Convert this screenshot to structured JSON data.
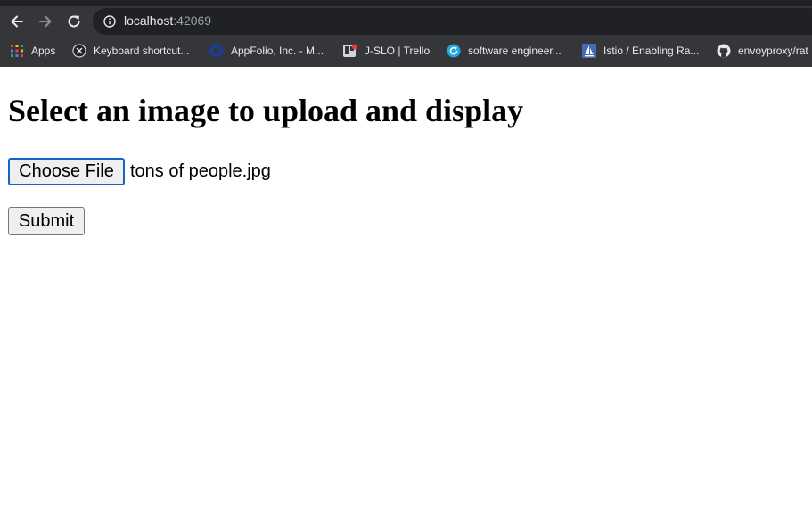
{
  "browser": {
    "url_host": "localhost",
    "url_port": ":42069",
    "icons": {
      "back": "back-arrow-icon",
      "forward": "forward-arrow-icon",
      "reload": "reload-icon",
      "info": "info-icon"
    },
    "colors": {
      "frame": "#35363a",
      "omnibox": "#202124",
      "text": "#e8eaed"
    }
  },
  "bookmarks": [
    {
      "label": "Apps",
      "icon": "apps-grid-icon"
    },
    {
      "label": "Keyboard shortcut...",
      "icon": "keyboard-x-icon"
    },
    {
      "label": "AppFolio, Inc. - M...",
      "icon": "appfolio-icon"
    },
    {
      "label": "J-SLO | Trello",
      "icon": "trello-icon"
    },
    {
      "label": "software engineer...",
      "icon": "circle-arrow-icon"
    },
    {
      "label": "Istio / Enabling Ra...",
      "icon": "istio-sail-icon"
    },
    {
      "label": "envoyproxy/rat",
      "icon": "github-icon"
    }
  ],
  "page": {
    "heading": "Select an image to upload and display",
    "choose_file_label": "Choose File",
    "selected_file": "tons of people.jpg",
    "submit_label": "Submit",
    "colors": {
      "focus_ring": "#1662c9",
      "button_bg": "#efefef"
    }
  }
}
